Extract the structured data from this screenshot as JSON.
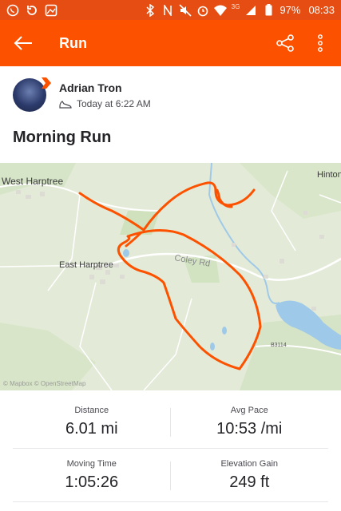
{
  "status_bar": {
    "battery": "97%",
    "time": "08:33",
    "network": "3G"
  },
  "app_bar": {
    "title": "Run"
  },
  "athlete": {
    "name": "Adrian Tron",
    "timestamp": "Today at 6:22 AM"
  },
  "activity": {
    "title": "Morning Run"
  },
  "map": {
    "labels": {
      "west_harptree": "West Harptree",
      "east_harptree": "East Harptree",
      "hinton": "Hinton",
      "road": "Coley Rd",
      "route_code": "B3114",
      "attribution": "© Mapbox © OpenStreetMap"
    },
    "route_color": "#fc5200"
  },
  "stats": {
    "distance": {
      "label": "Distance",
      "value": "6.01 mi"
    },
    "pace": {
      "label": "Avg Pace",
      "value": "10:53 /mi"
    },
    "moving_time": {
      "label": "Moving Time",
      "value": "1:05:26"
    },
    "elevation": {
      "label": "Elevation Gain",
      "value": "249 ft"
    }
  },
  "colors": {
    "brand": "#fc5200",
    "status": "#e54d13",
    "text": "#242428"
  }
}
